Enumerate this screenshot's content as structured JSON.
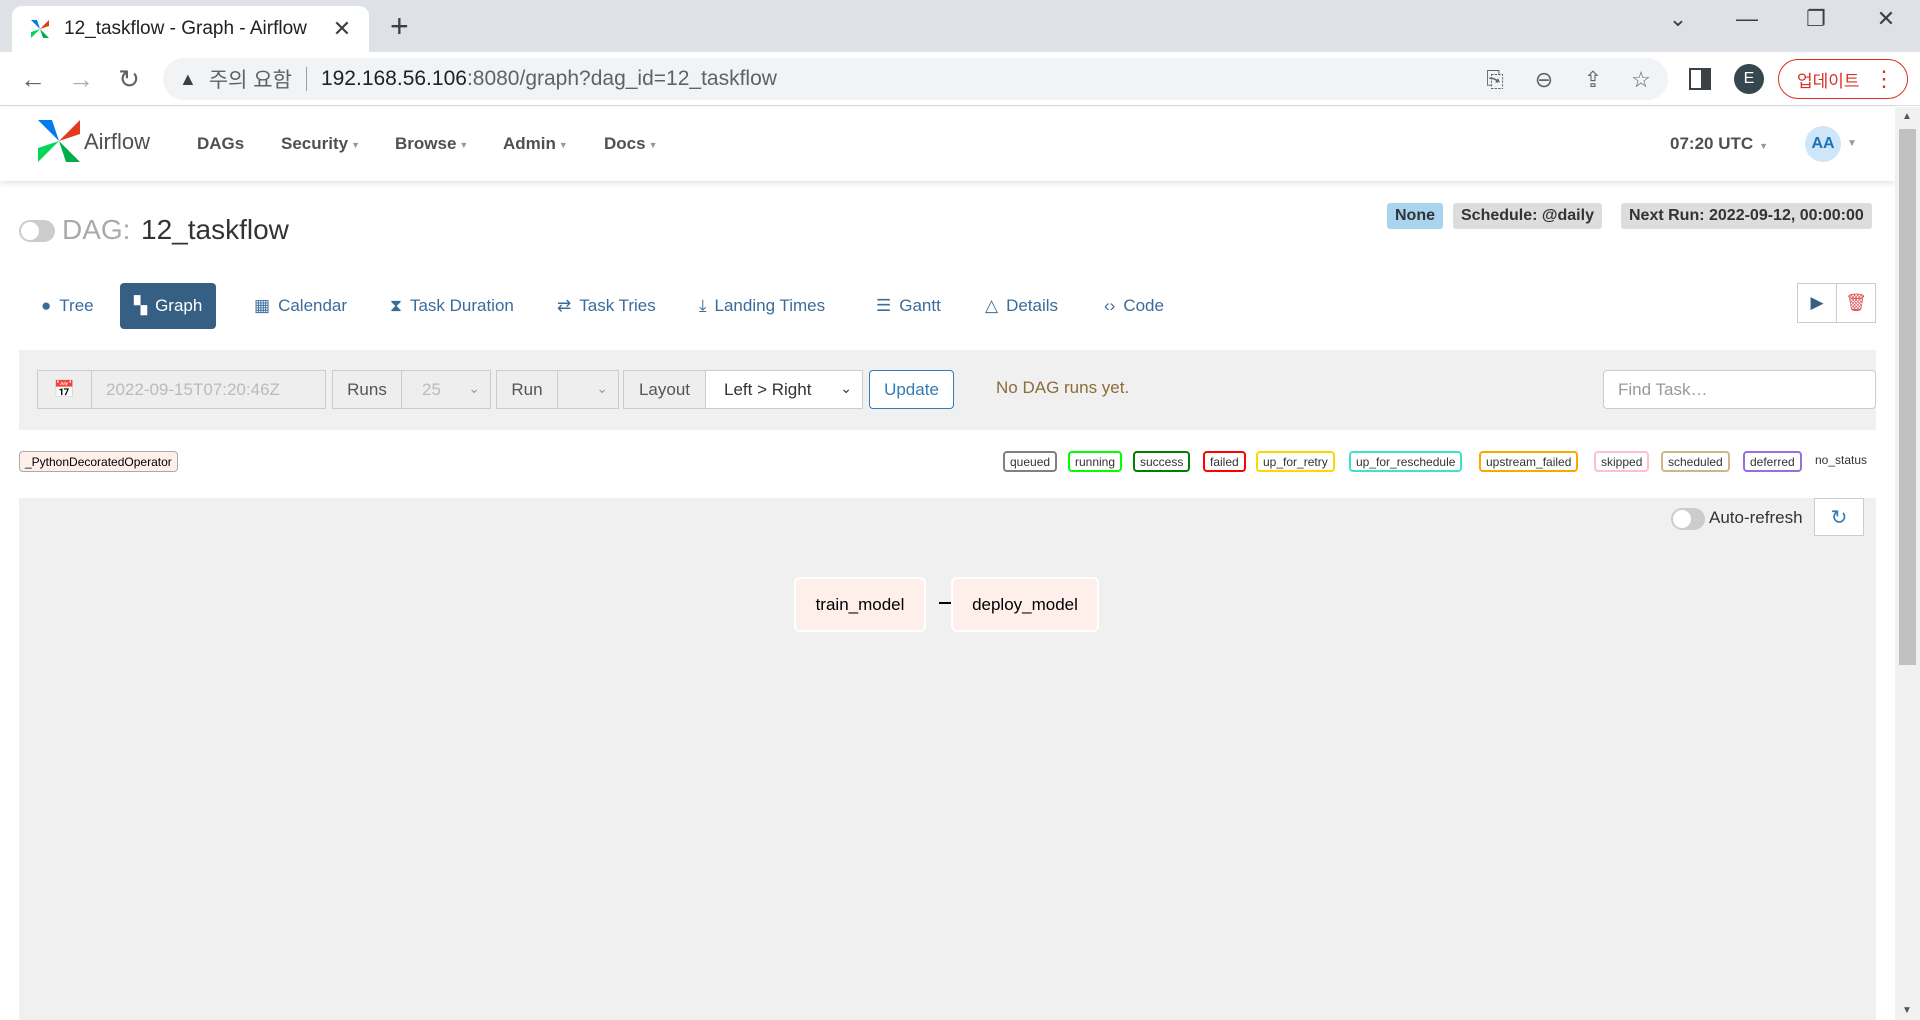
{
  "browser": {
    "tab_title": "12_taskflow - Graph - Airflow",
    "security_warning": "주의 요함",
    "url_host": "192.168.56.106",
    "url_rest": ":8080/graph?dag_id=12_taskflow",
    "profile_initial": "E",
    "update_label": "업데이트"
  },
  "navbar": {
    "brand": "Airflow",
    "menu": [
      "DAGs",
      "Security",
      "Browse",
      "Admin",
      "Docs"
    ],
    "time": "07:20 UTC",
    "avatar": "AA"
  },
  "dag": {
    "label": "DAG:",
    "id": "12_taskflow",
    "badges": {
      "state": "None",
      "schedule": "Schedule: @daily",
      "next_run": "Next Run: 2022-09-12, 00:00:00"
    }
  },
  "view_tabs": [
    "Tree",
    "Graph",
    "Calendar",
    "Task Duration",
    "Task Tries",
    "Landing Times",
    "Gantt",
    "Details",
    "Code"
  ],
  "active_tab": "Graph",
  "controls": {
    "base_date": "2022-09-15T07:20:46Z",
    "runs_label": "Runs",
    "runs_value": "25",
    "run_label": "Run",
    "layout_label": "Layout",
    "layout_value": "Left > Right",
    "update_label": "Update",
    "no_runs_message": "No DAG runs yet.",
    "find_task_placeholder": "Find Task…"
  },
  "legend": {
    "operator": "_PythonDecoratedOperator",
    "states": [
      {
        "label": "queued",
        "color": "#808080"
      },
      {
        "label": "running",
        "color": "#00ff00"
      },
      {
        "label": "success",
        "color": "#008000"
      },
      {
        "label": "failed",
        "color": "#ff0000"
      },
      {
        "label": "up_for_retry",
        "color": "#ffd700"
      },
      {
        "label": "up_for_reschedule",
        "color": "#40e0d0"
      },
      {
        "label": "upstream_failed",
        "color": "#ffa500"
      },
      {
        "label": "skipped",
        "color": "#ffc0cb"
      },
      {
        "label": "scheduled",
        "color": "#d2b48c"
      },
      {
        "label": "deferred",
        "color": "#9370db"
      }
    ],
    "no_status": "no_status"
  },
  "graph": {
    "auto_refresh_label": "Auto-refresh",
    "tasks": [
      "train_model",
      "deploy_model"
    ]
  },
  "colors": {
    "accent": "#365f84",
    "operator_fill": "#ffefeb",
    "link": "#3a6c9b"
  }
}
